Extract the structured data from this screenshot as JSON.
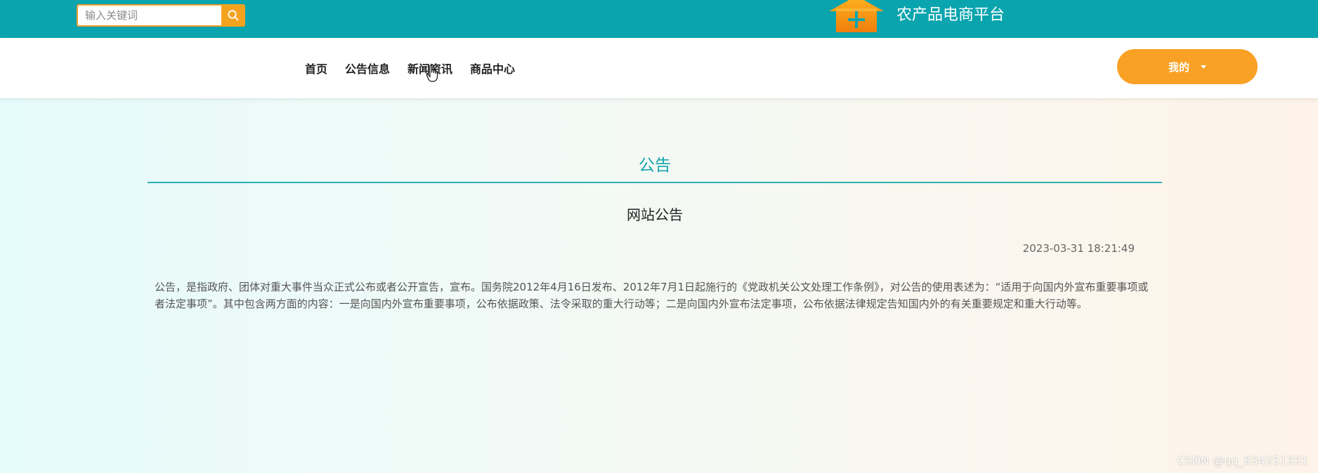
{
  "topbar": {
    "search": {
      "placeholder": "输入关键词",
      "value": ""
    },
    "search_icon": "search-icon",
    "logo_icon": "house-plus-logo",
    "site_title": "农产品电商平台",
    "colors": {
      "background": "#0aa4ae",
      "accent": "#f5a21f"
    }
  },
  "nav": {
    "items": [
      {
        "label": "首页"
      },
      {
        "label": "公告信息"
      },
      {
        "label": "新闻资讯"
      },
      {
        "label": "商品中心"
      }
    ],
    "user_button": {
      "label": "我的",
      "icon": "caret-down-icon"
    }
  },
  "content": {
    "section_title": "公告",
    "article": {
      "title": "网站公告",
      "date": "2023-03-31 18:21:49",
      "body": "公告，是指政府、团体对重大事件当众正式公布或者公开宣告，宣布。国务院2012年4月16日发布、2012年7月1日起施行的《党政机关公文处理工作条例》，对公告的使用表述为：“适用于向国内外宣布重要事项或者法定事项”。其中包含两方面的内容：一是向国内外宣布重要事项，公布依据政策、法令采取的重大行动等；二是向国内外宣布法定事项，公布依据法律规定告知国内外的有关重要规定和重大行动等。"
    }
  },
  "watermark": "CSDN @qq_834251331"
}
